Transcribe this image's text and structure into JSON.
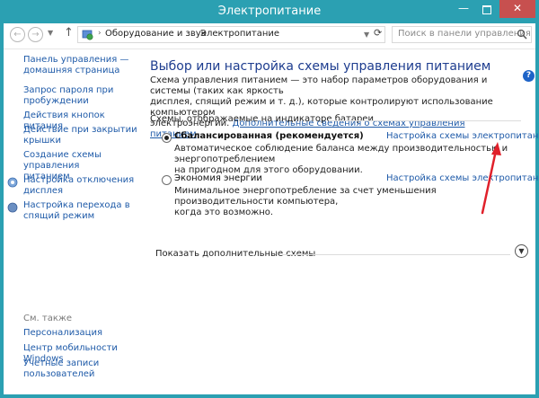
{
  "window": {
    "title": "Электропитание",
    "min_glyph": "—",
    "close_glyph": "✕"
  },
  "addressbar": {
    "breadcrumbs": [
      "Оборудование и звук",
      "Электропитание"
    ],
    "breadcrumb_sep": "›",
    "search_placeholder": "Поиск в панели управления",
    "icons": [
      "back-arrow-icon",
      "forward-arrow-icon",
      "up-arrow-icon",
      "control-panel-icon",
      "refresh-icon",
      "search-icon"
    ]
  },
  "sidebar": {
    "home": [
      "Панель управления —",
      "домашняя страница"
    ],
    "items": [
      {
        "lines": [
          "Запрос пароля при",
          "пробуждении"
        ]
      },
      {
        "lines": [
          "Действия кнопок питания"
        ]
      },
      {
        "lines": [
          "Действие при закрытии",
          "крышки"
        ]
      },
      {
        "lines": [
          "Создание схемы управления",
          "питанием"
        ]
      },
      {
        "lines": [
          "Настройка отключения",
          "дисплея"
        ]
      },
      {
        "lines": [
          "Настройка перехода в",
          "спящий режим"
        ]
      }
    ],
    "see_also_label": "См. также",
    "see_also": [
      {
        "lines": [
          "Персонализация"
        ]
      },
      {
        "lines": [
          "Центр мобильности Windows"
        ]
      },
      {
        "lines": [
          "Учетные записи",
          "пользователей"
        ]
      }
    ]
  },
  "main": {
    "title": "Выбор или настройка схемы управления питанием",
    "description_lines": [
      "Схема управления питанием — это набор параметров оборудования и системы (таких как яркость",
      "дисплея, спящий режим и т. д.), которые контролируют использование компьютером",
      "электроэнергии."
    ],
    "description_link": "Дополнительные сведения о схемах управления питанием",
    "section_label": "Схемы, отображаемые на индикаторе батареи",
    "plans": [
      {
        "name": "Сбалансированная (рекомендуется)",
        "selected": true,
        "link": "Настройка схемы электропитания",
        "desc_lines": [
          "Автоматическое соблюдение баланса между производительностью и энергопотреблением",
          "на пригодном для этого оборудовании."
        ]
      },
      {
        "name": "Экономия энергии",
        "selected": false,
        "link": "Настройка схемы электропитания",
        "desc_lines": [
          "Минимальное энергопотребление за счет уменьшения производительности компьютера,",
          "когда это возможно."
        ]
      }
    ],
    "more_plans_label": "Показать дополнительные схемы",
    "help_glyph": "?"
  },
  "colors": {
    "title_bar": "#2ba0b2",
    "close_button": "#c7504f",
    "link": "#1e5aa8",
    "heading": "#1e3d8f",
    "annotation_arrow": "#e0202a"
  }
}
